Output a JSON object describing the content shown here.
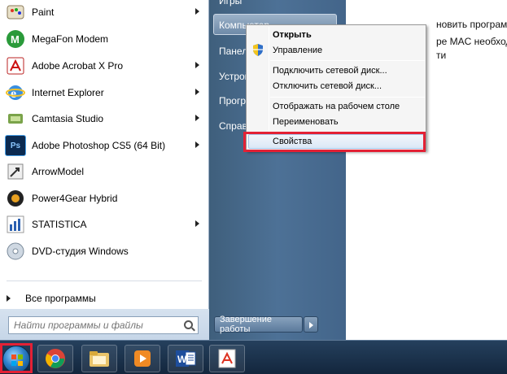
{
  "background_text": [
    "новить программу",
    "ре MAC необходим",
    "ти"
  ],
  "programs": [
    {
      "label": "Paint",
      "icon": "paint-icon",
      "has_submenu": true
    },
    {
      "label": "MegaFon Modem",
      "icon": "megafon-icon",
      "has_submenu": false
    },
    {
      "label": "Adobe Acrobat X Pro",
      "icon": "acrobat-icon",
      "has_submenu": true
    },
    {
      "label": "Internet Explorer",
      "icon": "internet-explorer-icon",
      "has_submenu": true
    },
    {
      "label": "Camtasia Studio",
      "icon": "camtasia-icon",
      "has_submenu": true
    },
    {
      "label": "Adobe Photoshop CS5 (64 Bit)",
      "icon": "photoshop-icon",
      "has_submenu": true
    },
    {
      "label": "ArrowModel",
      "icon": "arrowmodel-icon",
      "has_submenu": false
    },
    {
      "label": "Power4Gear Hybrid",
      "icon": "power4gear-icon",
      "has_submenu": false
    },
    {
      "label": "STATISTICA",
      "icon": "statistica-icon",
      "has_submenu": true
    },
    {
      "label": "DVD-студия Windows",
      "icon": "dvd-studio-icon",
      "has_submenu": false
    }
  ],
  "all_programs": "Все программы",
  "search": {
    "placeholder": "Найти программы и файлы"
  },
  "right_pane": {
    "games": "Игры",
    "computer": "Компьютер",
    "control_panel": "Панель",
    "devices": "Устройс",
    "programs": "Програ",
    "help": "Справк",
    "shutdown": "Завершение работы"
  },
  "context_menu": {
    "open": "Открыть",
    "manage": "Управление",
    "map_drive": "Подключить сетевой диск...",
    "disconnect_drive": "Отключить сетевой диск...",
    "show_desktop": "Отображать на рабочем столе",
    "rename": "Переименовать",
    "properties": "Свойства"
  },
  "taskbar": {
    "apps": [
      "chrome-icon",
      "explorer-icon",
      "media-player-icon",
      "word-icon",
      "acrobat-icon"
    ],
    "word_label": "W"
  },
  "colors": {
    "highlight_red": "#e32135",
    "start_pane": "#4d7196"
  }
}
